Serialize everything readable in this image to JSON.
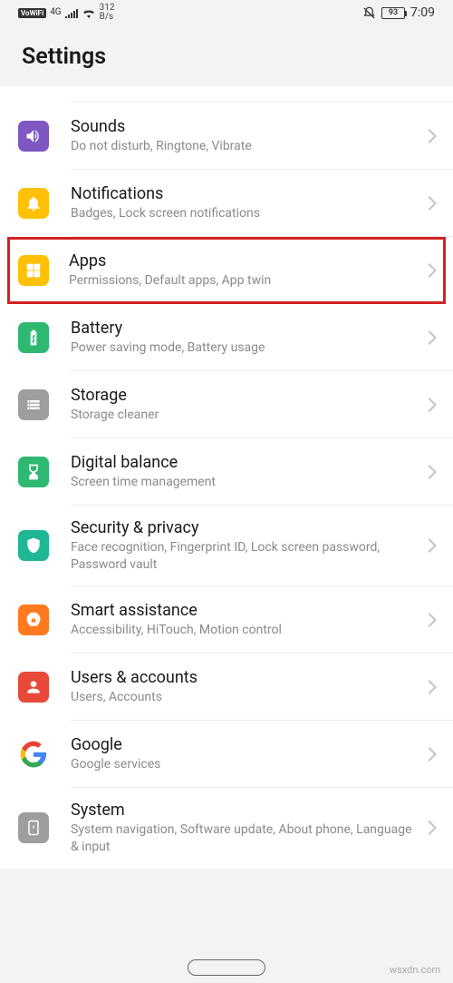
{
  "status": {
    "vowifi": "VoWiFi",
    "network": "4G",
    "speed_top": "312",
    "speed_bot": "B/s",
    "battery": "93",
    "time": "7:09"
  },
  "header": {
    "title": "Settings"
  },
  "items": [
    {
      "title": "Sounds",
      "subtitle": "Do not disturb, Ringtone, Vibrate"
    },
    {
      "title": "Notifications",
      "subtitle": "Badges, Lock screen notifications"
    },
    {
      "title": "Apps",
      "subtitle": "Permissions, Default apps, App twin"
    },
    {
      "title": "Battery",
      "subtitle": "Power saving mode, Battery usage"
    },
    {
      "title": "Storage",
      "subtitle": "Storage cleaner"
    },
    {
      "title": "Digital balance",
      "subtitle": "Screen time management"
    },
    {
      "title": "Security & privacy",
      "subtitle": "Face recognition, Fingerprint ID, Lock screen password, Password vault"
    },
    {
      "title": "Smart assistance",
      "subtitle": "Accessibility, HiTouch, Motion control"
    },
    {
      "title": "Users & accounts",
      "subtitle": "Users, Accounts"
    },
    {
      "title": "Google",
      "subtitle": "Google services"
    },
    {
      "title": "System",
      "subtitle": "System navigation, Software update, About phone, Language & input"
    }
  ],
  "colors": {
    "purple": "#7e57c2",
    "yellow": "#ffc107",
    "green": "#2fb872",
    "greenTeal": "#1fb695",
    "gray": "#9e9e9e",
    "orange": "#ff7a1e",
    "red": "#e84a3a"
  },
  "watermark": "wsxdn.com"
}
